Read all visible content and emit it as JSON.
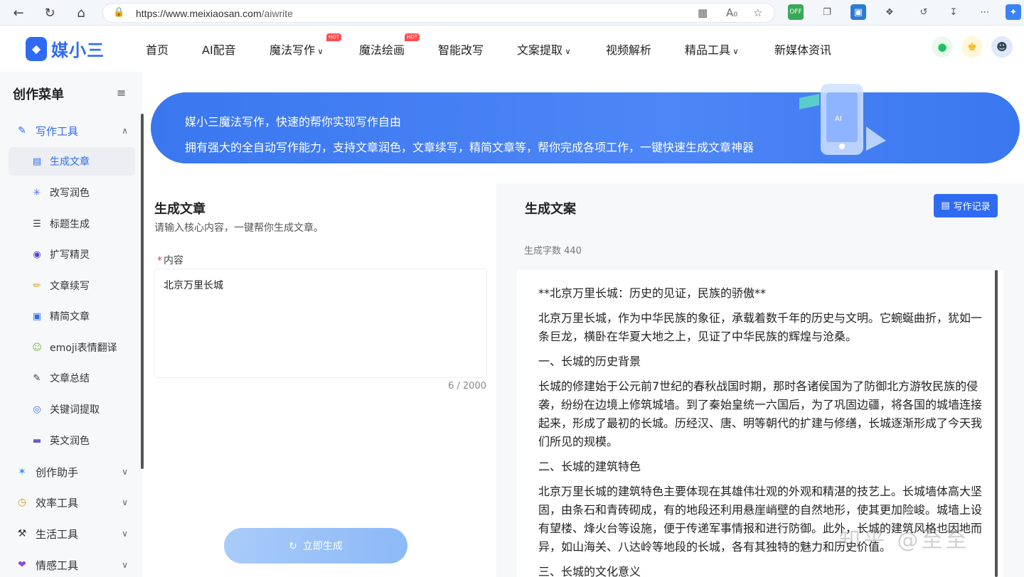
{
  "browser": {
    "url_host": "https://www.meixiaosan.com",
    "url_path": "/aiwrite"
  },
  "header": {
    "logo_text": "媒小三",
    "nav": [
      {
        "label": "首页"
      },
      {
        "label": "AI配音"
      },
      {
        "label": "魔法写作",
        "hot": "HOT"
      },
      {
        "label": "魔法绘画",
        "hot": "HOT"
      },
      {
        "label": "智能改写"
      },
      {
        "label": "文案提取"
      },
      {
        "label": "视频解析"
      },
      {
        "label": "精品工具"
      },
      {
        "label": "新媒体资讯"
      }
    ]
  },
  "sidebar": {
    "title": "创作菜单",
    "group_writing": "写作工具",
    "items": [
      {
        "label": "生成文章"
      },
      {
        "label": "改写润色"
      },
      {
        "label": "标题生成"
      },
      {
        "label": "扩写精灵"
      },
      {
        "label": "文章续写"
      },
      {
        "label": "精简文章"
      },
      {
        "label": "emoji表情翻译"
      },
      {
        "label": "文章总结"
      },
      {
        "label": "关键词提取"
      },
      {
        "label": "英文润色"
      }
    ],
    "groups": [
      {
        "label": "创作助手"
      },
      {
        "label": "效率工具"
      },
      {
        "label": "生活工具"
      },
      {
        "label": "情感工具"
      }
    ]
  },
  "banner": {
    "line1": "媒小三魔法写作，快速的帮你实现写作自由",
    "line2": "拥有强大的全自动写作能力，支持文章润色，文章续写，精简文章等，帮你完成各项工作，一键快速生成文章神器"
  },
  "form": {
    "title": "生成文章",
    "subtitle": "请输入核心内容，一键帮你生成文章。",
    "required_mark": "*",
    "field_label": "内容",
    "content_value": "北京万里长城",
    "counter": "6 / 2000",
    "generate_label": "立即生成"
  },
  "result": {
    "title": "生成文案",
    "record_label": "写作记录",
    "word_count": "生成字数 440",
    "paragraphs": [
      "**北京万里长城：历史的见证，民族的骄傲**",
      "北京万里长城，作为中华民族的象征，承载着数千年的历史与文明。它蜿蜒曲折，犹如一条巨龙，横卧在华夏大地之上，见证了中华民族的辉煌与沧桑。",
      "一、长城的历史背景",
      "长城的修建始于公元前7世纪的春秋战国时期，那时各诸侯国为了防御北方游牧民族的侵袭，纷纷在边境上修筑城墙。到了秦始皇统一六国后，为了巩固边疆，将各国的城墙连接起来，形成了最初的长城。历经汉、唐、明等朝代的扩建与修缮，长城逐渐形成了今天我们所见的规模。",
      "二、长城的建筑特色",
      "北京万里长城的建筑特色主要体现在其雄伟壮观的外观和精湛的技艺上。长城墙体高大坚固，由条石和青砖砌成，有的地段还利用悬崖峭壁的自然地形，使其更加险峻。城墙上设有望楼、烽火台等设施，便于传递军事情报和进行防御。此外，长城的建筑风格也因地而异，如山海关、八达岭等地段的长城，各有其独特的魅力和历史价值。",
      "三、长城的文化意义"
    ]
  },
  "watermark": "知乎 @至至"
}
